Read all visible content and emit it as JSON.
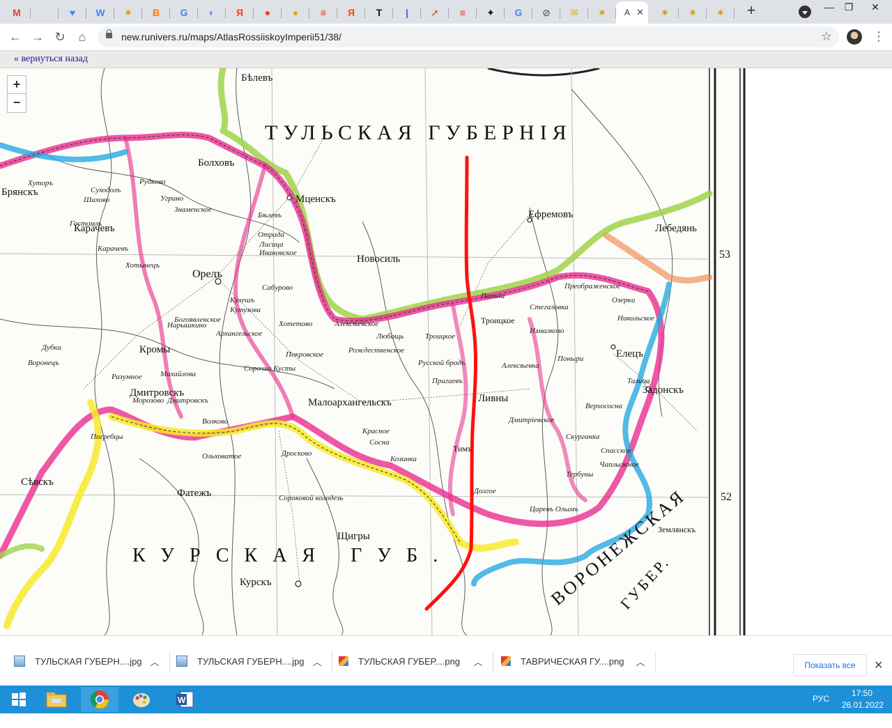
{
  "browser": {
    "tabs": [
      {
        "icon": "gmail-icon",
        "letter": "M",
        "color": "#ea4335"
      },
      {
        "icon": "sheets-icon",
        "letter": "",
        "color": "#34a853"
      },
      {
        "icon": "heart-icon",
        "letter": "♥",
        "color": "#4285f4"
      },
      {
        "icon": "wikipedia-icon",
        "letter": "W",
        "color": "#ffffff"
      },
      {
        "icon": "runivers-icon",
        "letter": "✷",
        "color": "#d89a2a"
      },
      {
        "icon": "blogger-icon",
        "letter": "B",
        "color": "#f57d00"
      },
      {
        "icon": "google-icon",
        "letter": "G",
        "color": "#ffffff"
      },
      {
        "icon": "location-icon",
        "letter": "◐",
        "color": "#4a90d9"
      },
      {
        "icon": "yandex-icon",
        "letter": "Я",
        "color": "#fc3f1d"
      },
      {
        "icon": "maps-pin-icon",
        "letter": "●",
        "color": "#e94235"
      },
      {
        "icon": "maps-pin-icon",
        "letter": "●",
        "color": "#f2a600"
      },
      {
        "icon": "news-icon",
        "letter": "≡",
        "color": "#d93025"
      },
      {
        "icon": "yandex-icon",
        "letter": "Я",
        "color": "#fc3f1d"
      },
      {
        "icon": "t-icon",
        "letter": "T",
        "color": "#111111"
      },
      {
        "icon": "bookmark-icon",
        "letter": "|",
        "color": "#3366cc"
      },
      {
        "icon": "arrow-icon",
        "letter": "➚",
        "color": "#e24a2a"
      },
      {
        "icon": "news-icon",
        "letter": "≡",
        "color": "#d93025"
      },
      {
        "icon": "compass-icon",
        "letter": "✦",
        "color": "#111111"
      },
      {
        "icon": "google-icon",
        "letter": "G",
        "color": "#ffffff"
      },
      {
        "icon": "lock-doc-icon",
        "letter": "⊘",
        "color": "#666666"
      },
      {
        "icon": "mail-icon",
        "letter": "✉",
        "color": "#e7a516"
      },
      {
        "icon": "runivers-icon",
        "letter": "✷",
        "color": "#d89a2a"
      }
    ],
    "active_tab": {
      "title": "A",
      "icon": "runivers-icon"
    },
    "trailing_tabs": [
      "runivers-icon",
      "runivers-icon",
      "runivers-icon"
    ],
    "new_tab_label": "+",
    "window_controls": {
      "minimize": "—",
      "restore": "❐",
      "close": "✕"
    },
    "url": "new.runivers.ru/maps/AtlasRossiiskoyImperii51/38/"
  },
  "page": {
    "back_link": "« вернуться назад",
    "zoom_in": "+",
    "zoom_out": "−"
  },
  "map": {
    "titles": {
      "tula": "ТУЛЬСКАЯ ГУБЕРНІЯ",
      "kursk": "КУРСКАЯ ГУБ.",
      "voronezh": "ВОРОНЕЖСКАЯ",
      "voronezh2": "ГУБЕР."
    },
    "towns": [
      "Бѣлевъ",
      "Болховъ",
      "Мценскъ",
      "Новосиль",
      "Ефремовъ",
      "Лебедянь",
      "Орелъ",
      "Кромы",
      "Малоархангельскъ",
      "Ливны",
      "Елецъ",
      "Задонскъ",
      "Дмитровскъ",
      "Карачевъ",
      "Сѣвскъ",
      "Фатежъ",
      "Щигры",
      "Курскъ",
      "Землянскъ",
      "Брянскъ",
      "Троицкое",
      "Тимъ"
    ],
    "villages": [
      "Хуторъ",
      "Суходолъ",
      "Рудково",
      "Угрино",
      "Знаменское",
      "Бѣлевъ",
      "Лисица",
      "Отрада",
      "Ивановское",
      "Сабурово",
      "Кулешъ",
      "Кутузова",
      "Хотетово",
      "Алексѣевское",
      "Любощь",
      "Рождественское",
      "Троицкое",
      "Покровское",
      "Сорочьи Кусты",
      "Русской бродъ",
      "Пригаевъ",
      "Дмитріевское",
      "Скурганка",
      "Спасское",
      "Тербуны",
      "Царевъ Олымъ",
      "Ольховатое",
      "Дросково",
      "Красное",
      "Сосна",
      "Козинка",
      "Алексѣевка",
      "Долгое",
      "Сороковой колодезь",
      "Поныри",
      "Верхососна",
      "Чаплыжное",
      "Измалково",
      "Стегаловка",
      "Преображенское",
      "Озерки",
      "Никольское",
      "Пальна",
      "Талица",
      "Дубки",
      "Воронецъ",
      "Погребцы",
      "Разумное",
      "Морозово",
      "Дмитровскъ",
      "Волково",
      "Михайлова",
      "Архангельское",
      "Гостомль",
      "Шахово",
      "Карачевъ",
      "Нарышкино",
      "Хотынецъ",
      "Богоявленское",
      "Успенское",
      "Красникова"
    ],
    "latitude_marks": [
      "53",
      "52"
    ]
  },
  "downloads": [
    {
      "name": "ТУЛЬСКАЯ ГУБЕРН....jpg",
      "type": "image-icon"
    },
    {
      "name": "ТУЛЬСКАЯ ГУБЕРН....jpg",
      "type": "image-icon"
    },
    {
      "name": "ТУЛЬСКАЯ ГУБЕР....png",
      "type": "paint-icon"
    },
    {
      "name": "ТАВРИЧЕСКАЯ ГУ....png",
      "type": "paint-icon"
    }
  ],
  "downloads_show_all": "Показать все",
  "taskbar": {
    "apps": [
      "start-icon",
      "explorer-icon",
      "chrome-icon",
      "paint-icon",
      "word-icon"
    ],
    "lang": "РУС",
    "time": "17:50",
    "date": "26.01.2022"
  }
}
